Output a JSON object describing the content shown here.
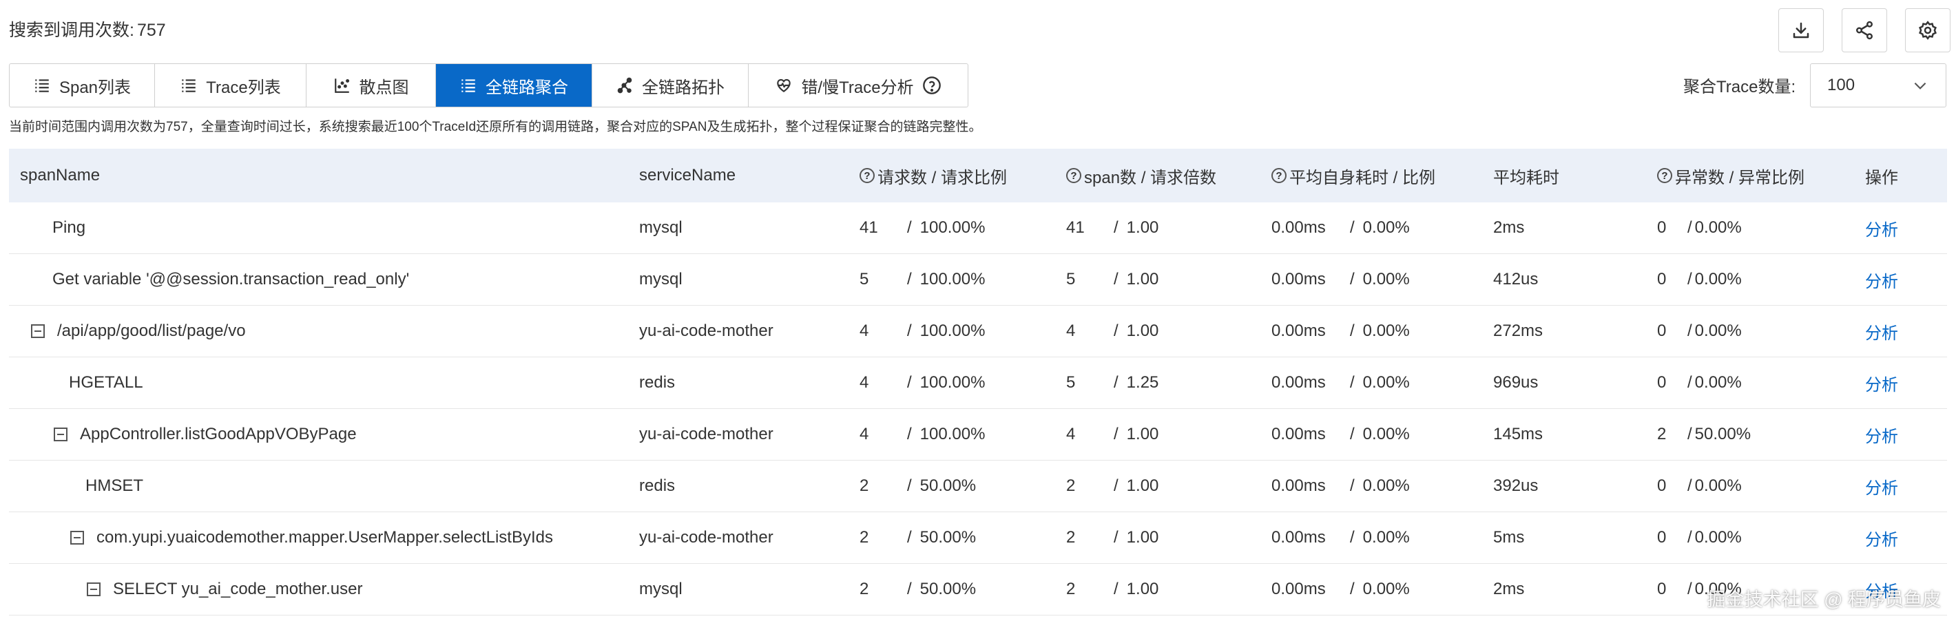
{
  "header": {
    "search_count_label": "搜索到调用次数:",
    "search_count_value": "757"
  },
  "toolbar": {
    "icons": [
      "download-icon",
      "share-icon",
      "gear-icon"
    ]
  },
  "tabs": [
    {
      "label": "Span列表",
      "icon": "list-icon",
      "active": false
    },
    {
      "label": "Trace列表",
      "icon": "list-icon",
      "active": false
    },
    {
      "label": "散点图",
      "icon": "scatter-icon",
      "active": false
    },
    {
      "label": "全链路聚合",
      "icon": "list-icon",
      "active": true
    },
    {
      "label": "全链路拓扑",
      "icon": "topology-icon",
      "active": false
    },
    {
      "label": "错/慢Trace分析",
      "icon": "heartbeat-icon",
      "active": false
    }
  ],
  "aggregate": {
    "label": "聚合Trace数量:",
    "value": "100"
  },
  "notice": "当前时间范围内调用次数为757，全量查询时间过长，系统搜索最近100个TraceId还原所有的调用链路，聚合对应的SPAN及生成拓扑，整个过程保证聚合的链路完整性。",
  "table": {
    "headers": {
      "span_name": "spanName",
      "service_name": "serviceName",
      "requests": "请求数 / 请求比例",
      "spans": "span数 / 请求倍数",
      "self_time": "平均自身耗时 / 比例",
      "avg_time": "平均耗时",
      "errors": "异常数 / 异常比例",
      "action": "操作"
    },
    "rows": [
      {
        "span": "Ping",
        "indent": 1,
        "toggle": false,
        "service": "mysql",
        "req": "41",
        "req_ratio": "100.00%",
        "spans": "41",
        "spans_mult": "1.00",
        "self": "0.00ms",
        "self_ratio": "0.00%",
        "avg": "2ms",
        "err": "0",
        "err_ratio": "0.00%",
        "action": "分析"
      },
      {
        "span": "Get variable '@@session.transaction_read_only'",
        "indent": 1,
        "toggle": false,
        "service": "mysql",
        "req": "5",
        "req_ratio": "100.00%",
        "spans": "5",
        "spans_mult": "1.00",
        "self": "0.00ms",
        "self_ratio": "0.00%",
        "avg": "412us",
        "err": "0",
        "err_ratio": "0.00%",
        "action": "分析"
      },
      {
        "span": "/api/app/good/list/page/vo",
        "indent": 0,
        "toggle": true,
        "service": "yu-ai-code-mother",
        "req": "4",
        "req_ratio": "100.00%",
        "spans": "4",
        "spans_mult": "1.00",
        "self": "0.00ms",
        "self_ratio": "0.00%",
        "avg": "272ms",
        "err": "0",
        "err_ratio": "0.00%",
        "action": "分析"
      },
      {
        "span": "HGETALL",
        "indent": 2,
        "toggle": false,
        "service": "redis",
        "req": "4",
        "req_ratio": "100.00%",
        "spans": "5",
        "spans_mult": "1.25",
        "self": "0.00ms",
        "self_ratio": "0.00%",
        "avg": "969us",
        "err": "0",
        "err_ratio": "0.00%",
        "action": "分析"
      },
      {
        "span": "AppController.listGoodAppVOByPage",
        "indent": 1,
        "toggle": true,
        "service": "yu-ai-code-mother",
        "req": "4",
        "req_ratio": "100.00%",
        "spans": "4",
        "spans_mult": "1.00",
        "self": "0.00ms",
        "self_ratio": "0.00%",
        "avg": "145ms",
        "err": "2",
        "err_ratio": "50.00%",
        "action": "分析"
      },
      {
        "span": "HMSET",
        "indent": 3,
        "toggle": false,
        "service": "redis",
        "req": "2",
        "req_ratio": "50.00%",
        "spans": "2",
        "spans_mult": "1.00",
        "self": "0.00ms",
        "self_ratio": "0.00%",
        "avg": "392us",
        "err": "0",
        "err_ratio": "0.00%",
        "action": "分析"
      },
      {
        "span": "com.yupi.yuaicodemother.mapper.UserMapper.selectListByIds",
        "indent": 2,
        "toggle": true,
        "service": "yu-ai-code-mother",
        "req": "2",
        "req_ratio": "50.00%",
        "spans": "2",
        "spans_mult": "1.00",
        "self": "0.00ms",
        "self_ratio": "0.00%",
        "avg": "5ms",
        "err": "0",
        "err_ratio": "0.00%",
        "action": "分析"
      },
      {
        "span": "SELECT yu_ai_code_mother.user",
        "indent": 3,
        "toggle": true,
        "service": "mysql",
        "req": "2",
        "req_ratio": "50.00%",
        "spans": "2",
        "spans_mult": "1.00",
        "self": "0.00ms",
        "self_ratio": "0.00%",
        "avg": "2ms",
        "err": "0",
        "err_ratio": "0.00%",
        "action": "分析"
      }
    ]
  },
  "watermark": "掘金技术社区 @ 程序员鱼皮"
}
